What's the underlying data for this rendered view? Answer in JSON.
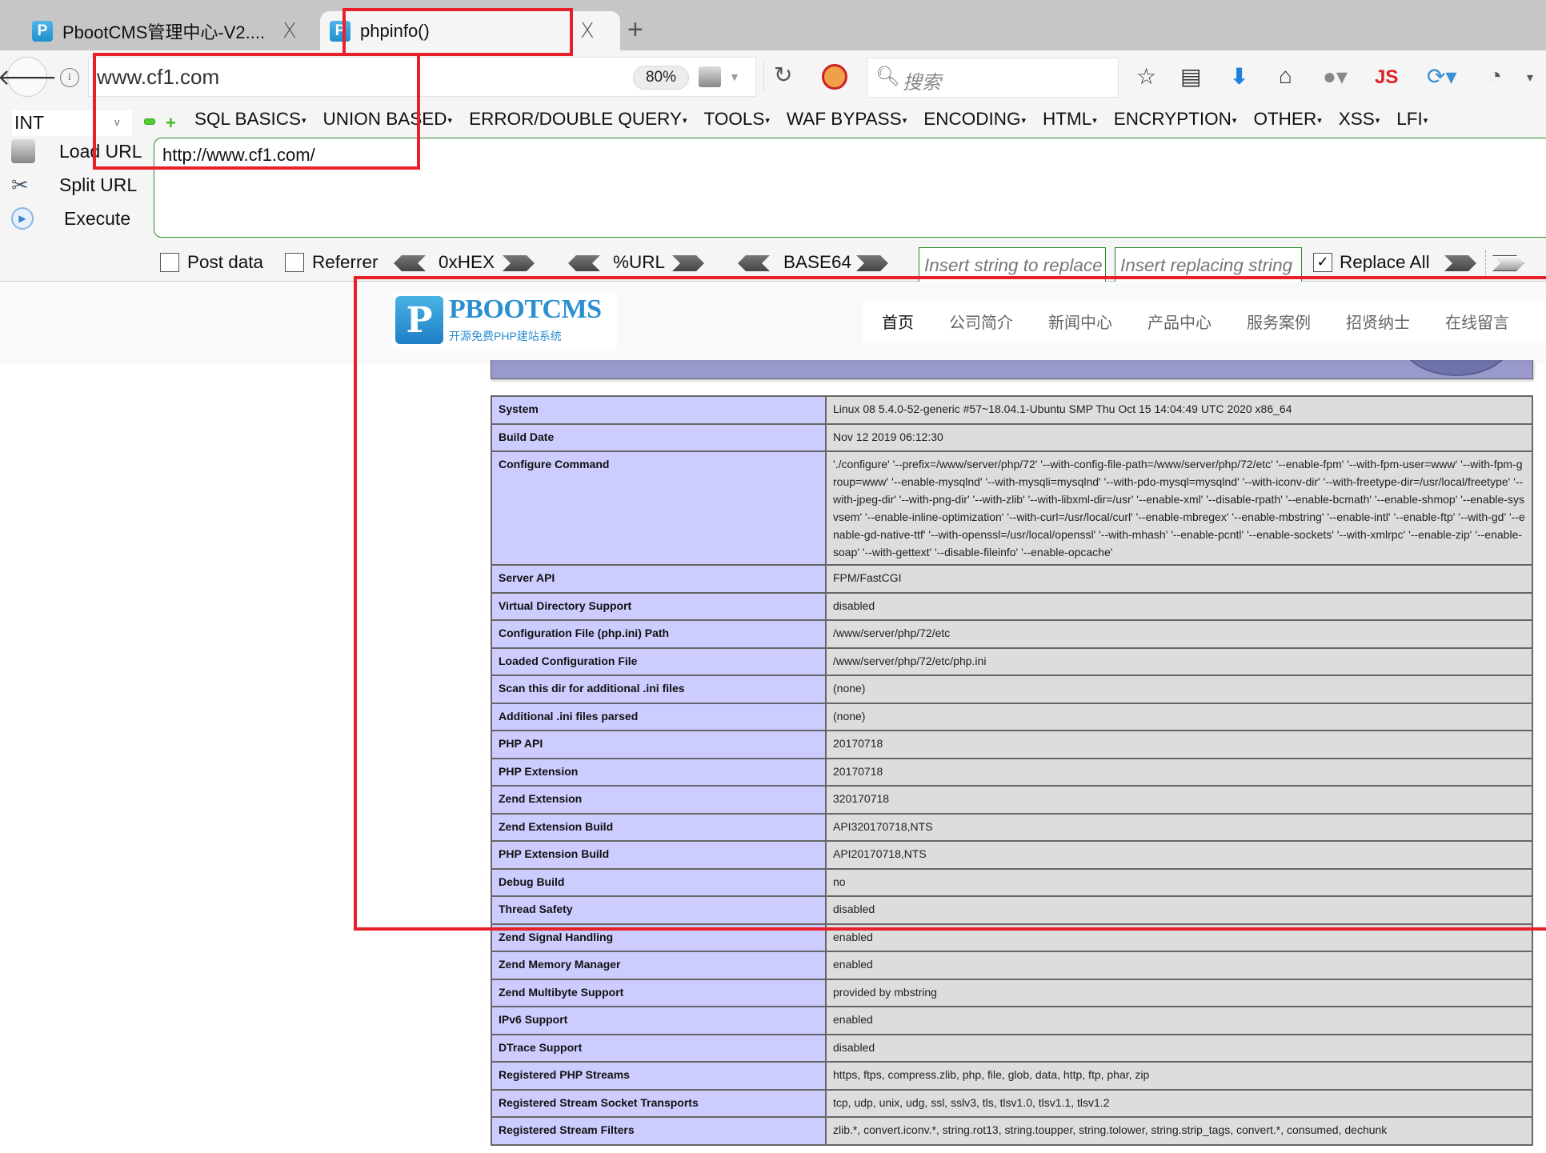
{
  "browser": {
    "tabs": [
      {
        "title": "PbootCMS管理中心-V2....",
        "active": false
      },
      {
        "title": "phpinfo()",
        "active": true
      }
    ],
    "new_tab_label": "+",
    "close_glyph": "X",
    "url": "www.cf1.com",
    "zoom": "80%",
    "search_placeholder": "搜索",
    "js_label": "JS"
  },
  "hackbar": {
    "select_value": "INT",
    "menus": [
      "SQL BASICS",
      "UNION BASED",
      "ERROR/DOUBLE QUERY",
      "TOOLS",
      "WAF BYPASS",
      "ENCODING",
      "HTML",
      "ENCRYPTION",
      "OTHER",
      "XSS",
      "LFI"
    ],
    "load_url": "Load URL",
    "split_url": "Split URL",
    "execute": "Execute",
    "url_value": "http://www.cf1.com/",
    "post_data": {
      "label": "Post data",
      "checked": false
    },
    "referrer": {
      "label": "Referrer",
      "checked": false
    },
    "encoders": [
      "0xHEX",
      "%URL",
      "BASE64"
    ],
    "replace_placeholder": "Insert string to replace",
    "replacing_placeholder": "Insert replacing string",
    "replace_all": {
      "label": "Replace All",
      "checked": true
    }
  },
  "site": {
    "logo_title": "PBOOTCMS",
    "logo_subtitle": "开源免费PHP建站系统",
    "nav": [
      "首页",
      "公司简介",
      "新闻中心",
      "产品中心",
      "服务案例",
      "招贤纳士",
      "在线留言"
    ],
    "active_nav": "首页"
  },
  "phpinfo": {
    "rows": [
      {
        "key": "System",
        "value": "Linux 08 5.4.0-52-generic #57~18.04.1-Ubuntu SMP Thu Oct 15 14:04:49 UTC 2020 x86_64"
      },
      {
        "key": "Build Date",
        "value": "Nov 12 2019 06:12:30"
      },
      {
        "key": "Configure Command",
        "value": "'./configure' '--prefix=/www/server/php/72' '--with-config-file-path=/www/server/php/72/etc' '--enable-fpm' '--with-fpm-user=www' '--with-fpm-group=www' '--enable-mysqlnd' '--with-mysqli=mysqlnd' '--with-pdo-mysql=mysqlnd' '--with-iconv-dir' '--with-freetype-dir=/usr/local/freetype' '--with-jpeg-dir' '--with-png-dir' '--with-zlib' '--with-libxml-dir=/usr' '--enable-xml' '--disable-rpath' '--enable-bcmath' '--enable-shmop' '--enable-sysvsem' '--enable-inline-optimization' '--with-curl=/usr/local/curl' '--enable-mbregex' '--enable-mbstring' '--enable-intl' '--enable-ftp' '--with-gd' '--enable-gd-native-ttf' '--with-openssl=/usr/local/openssl' '--with-mhash' '--enable-pcntl' '--enable-sockets' '--with-xmlrpc' '--enable-zip' '--enable-soap' '--with-gettext' '--disable-fileinfo' '--enable-opcache'"
      },
      {
        "key": "Server API",
        "value": "FPM/FastCGI"
      },
      {
        "key": "Virtual Directory Support",
        "value": "disabled"
      },
      {
        "key": "Configuration File (php.ini) Path",
        "value": "/www/server/php/72/etc"
      },
      {
        "key": "Loaded Configuration File",
        "value": "/www/server/php/72/etc/php.ini"
      },
      {
        "key": "Scan this dir for additional .ini files",
        "value": "(none)"
      },
      {
        "key": "Additional .ini files parsed",
        "value": "(none)"
      },
      {
        "key": "PHP API",
        "value": "20170718"
      },
      {
        "key": "PHP Extension",
        "value": "20170718"
      },
      {
        "key": "Zend Extension",
        "value": "320170718"
      },
      {
        "key": "Zend Extension Build",
        "value": "API320170718,NTS"
      },
      {
        "key": "PHP Extension Build",
        "value": "API20170718,NTS"
      },
      {
        "key": "Debug Build",
        "value": "no"
      },
      {
        "key": "Thread Safety",
        "value": "disabled"
      },
      {
        "key": "Zend Signal Handling",
        "value": "enabled"
      },
      {
        "key": "Zend Memory Manager",
        "value": "enabled"
      },
      {
        "key": "Zend Multibyte Support",
        "value": "provided by mbstring"
      },
      {
        "key": "IPv6 Support",
        "value": "enabled"
      },
      {
        "key": "DTrace Support",
        "value": "disabled"
      },
      {
        "key": "Registered PHP Streams",
        "value": "https, ftps, compress.zlib, php, file, glob, data, http, ftp, phar, zip"
      },
      {
        "key": "Registered Stream Socket Transports",
        "value": "tcp, udp, unix, udg, ssl, sslv3, tls, tlsv1.0, tlsv1.1, tlsv1.2"
      },
      {
        "key": "Registered Stream Filters",
        "value": "zlib.*, convert.iconv.*, string.rot13, string.toupper, string.tolower, string.strip_tags, convert.*, consumed, dechunk"
      }
    ]
  },
  "colors": {
    "annotation_red": "#e8202a",
    "php_key_bg": "#ccccff",
    "php_value_bg": "#dddddd",
    "php_banner": "#9999cc",
    "hackbar_border_green": "#2a8a2a",
    "brand_blue": "#2b8fd0"
  }
}
